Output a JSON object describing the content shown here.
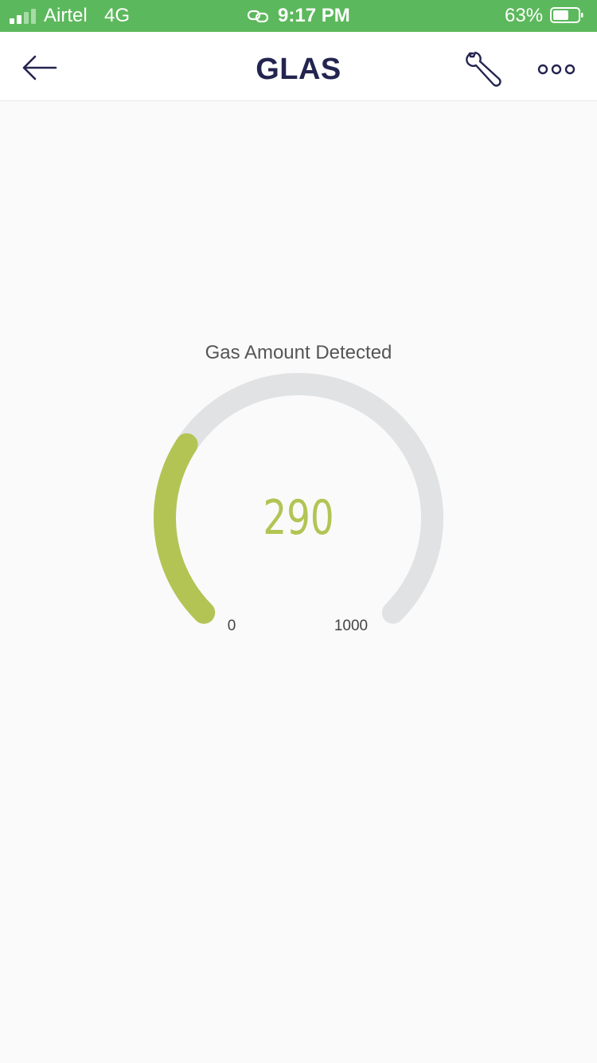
{
  "status_bar": {
    "carrier": "Airtel",
    "network": "4G",
    "time": "9:17 PM",
    "battery_percent": "63%",
    "battery_level": 0.63,
    "icons": [
      "signal-icon",
      "link-icon",
      "battery-icon"
    ]
  },
  "header": {
    "title": "GLAS",
    "icons": [
      "back-arrow-icon",
      "wrench-icon",
      "more-dots-icon"
    ],
    "colors": {
      "title": "#23244f",
      "status_bar_bg": "#5cb85c"
    }
  },
  "gauge_widget": {
    "label": "Gas Amount Detected",
    "value": "290",
    "min_label": "0",
    "max_label": "1000",
    "min": 0,
    "max": 1000,
    "reading": 290,
    "colors": {
      "fill": "#b3c454",
      "track": "#e1e2e4"
    }
  }
}
